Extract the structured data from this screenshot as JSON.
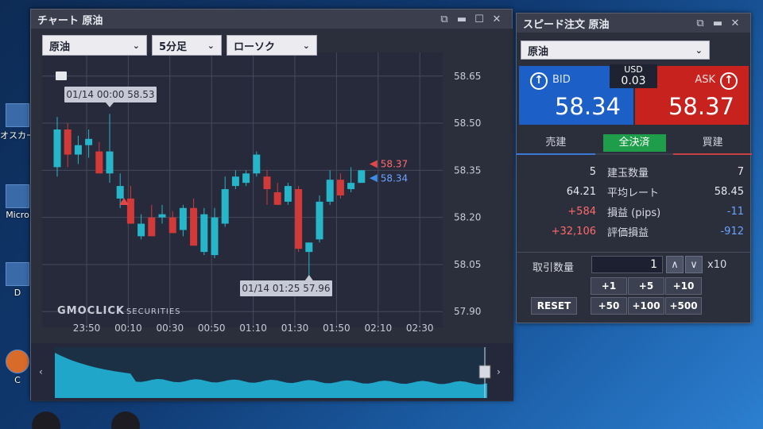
{
  "desktop": {
    "icons": [
      {
        "label": "オスカー"
      },
      {
        "label": "Micro"
      },
      {
        "label": "D"
      },
      {
        "label": "C"
      }
    ]
  },
  "chart_window": {
    "title": "チャート 原油",
    "instrument": "原油",
    "timeframe": "5分足",
    "chart_type": "ローソク",
    "logo": "GMOCLICK",
    "logo_suffix": "SECURITIES",
    "window_controls": {
      "settings": "⧉",
      "minimize": "▬",
      "maximize": "☐",
      "close": "✕"
    }
  },
  "chart_data": {
    "type": "candlestick",
    "x_tick_labels": [
      "23:50",
      "00:10",
      "00:30",
      "00:50",
      "01:10",
      "01:30",
      "01:50",
      "02:10",
      "02:30"
    ],
    "y_tick_labels": [
      "58.65",
      "58.50",
      "58.35",
      "58.20",
      "58.05",
      "57.90"
    ],
    "ylim": [
      57.85,
      58.7
    ],
    "bid_line": "58.34",
    "ask_line": "58.37",
    "high_annotation": "01/14 00:00 58.53",
    "low_annotation": "01/14 01:25 57.96",
    "up_color": "#26b5c9",
    "down_color": "#d23a3a",
    "candles": [
      {
        "o": 58.36,
        "h": 58.52,
        "l": 58.33,
        "c": 58.48
      },
      {
        "o": 58.48,
        "h": 58.5,
        "l": 58.36,
        "c": 58.4
      },
      {
        "o": 58.4,
        "h": 58.46,
        "l": 58.37,
        "c": 58.43
      },
      {
        "o": 58.43,
        "h": 58.48,
        "l": 58.39,
        "c": 58.45
      },
      {
        "o": 58.41,
        "h": 58.44,
        "l": 58.37,
        "c": 58.34
      },
      {
        "o": 58.34,
        "h": 58.53,
        "l": 58.31,
        "c": 58.41
      },
      {
        "o": 58.26,
        "h": 58.34,
        "l": 58.23,
        "c": 58.3
      },
      {
        "o": 58.26,
        "h": 58.3,
        "l": 58.21,
        "c": 58.18
      },
      {
        "o": 58.14,
        "h": 58.21,
        "l": 58.13,
        "c": 58.18
      },
      {
        "o": 58.2,
        "h": 58.24,
        "l": 58.14,
        "c": 58.14
      },
      {
        "o": 58.2,
        "h": 58.24,
        "l": 58.18,
        "c": 58.21
      },
      {
        "o": 58.2,
        "h": 58.22,
        "l": 58.16,
        "c": 58.15
      },
      {
        "o": 58.16,
        "h": 58.24,
        "l": 58.14,
        "c": 58.23
      },
      {
        "o": 58.23,
        "h": 58.26,
        "l": 58.11,
        "c": 58.11
      },
      {
        "o": 58.09,
        "h": 58.23,
        "l": 58.08,
        "c": 58.21
      },
      {
        "o": 58.08,
        "h": 58.23,
        "l": 58.07,
        "c": 58.2
      },
      {
        "o": 58.18,
        "h": 58.33,
        "l": 58.17,
        "c": 58.29
      },
      {
        "o": 58.3,
        "h": 58.35,
        "l": 58.29,
        "c": 58.33
      },
      {
        "o": 58.31,
        "h": 58.35,
        "l": 58.3,
        "c": 58.34
      },
      {
        "o": 58.34,
        "h": 58.41,
        "l": 58.33,
        "c": 58.4
      },
      {
        "o": 58.33,
        "h": 58.35,
        "l": 58.24,
        "c": 58.29
      },
      {
        "o": 58.28,
        "h": 58.31,
        "l": 58.24,
        "c": 58.24
      },
      {
        "o": 58.25,
        "h": 58.31,
        "l": 58.24,
        "c": 58.3
      },
      {
        "o": 58.29,
        "h": 58.3,
        "l": 58.09,
        "c": 58.1
      },
      {
        "o": 58.09,
        "h": 58.12,
        "l": 57.96,
        "c": 58.12
      },
      {
        "o": 58.13,
        "h": 58.27,
        "l": 58.12,
        "c": 58.25
      },
      {
        "o": 58.25,
        "h": 58.35,
        "l": 58.24,
        "c": 58.32
      },
      {
        "o": 58.32,
        "h": 58.34,
        "l": 58.26,
        "c": 58.27
      },
      {
        "o": 58.29,
        "h": 58.36,
        "l": 58.28,
        "c": 58.31
      },
      {
        "o": 58.31,
        "h": 58.35,
        "l": 58.31,
        "c": 58.35
      }
    ]
  },
  "order_window": {
    "title": "スピード注文 原油",
    "instrument": "原油",
    "bid_label": "BID",
    "bid_price": "58.34",
    "ask_label": "ASK",
    "ask_price": "58.37",
    "spread_currency": "USD",
    "spread_value": "0.03",
    "tabs": {
      "sell": "売建",
      "all": "全決済",
      "buy": "買建"
    },
    "positions": [
      {
        "left": "5",
        "label": "建玉数量",
        "right": "7"
      },
      {
        "left": "64.21",
        "label": "平均レート",
        "right": "58.45"
      },
      {
        "left": "+584",
        "label": "損益 (pips)",
        "right": "-11"
      },
      {
        "left": "+32,106",
        "label": "評価損益",
        "right": "-912"
      }
    ],
    "qty_label": "取引数量",
    "qty_value": "1",
    "qty_multiplier": "x10",
    "increments": [
      "+1",
      "+5",
      "+10",
      "+50",
      "+100",
      "+500"
    ],
    "reset_label": "RESET",
    "window_controls": {
      "settings": "⧉",
      "minimize": "▬",
      "close": "✕"
    }
  }
}
